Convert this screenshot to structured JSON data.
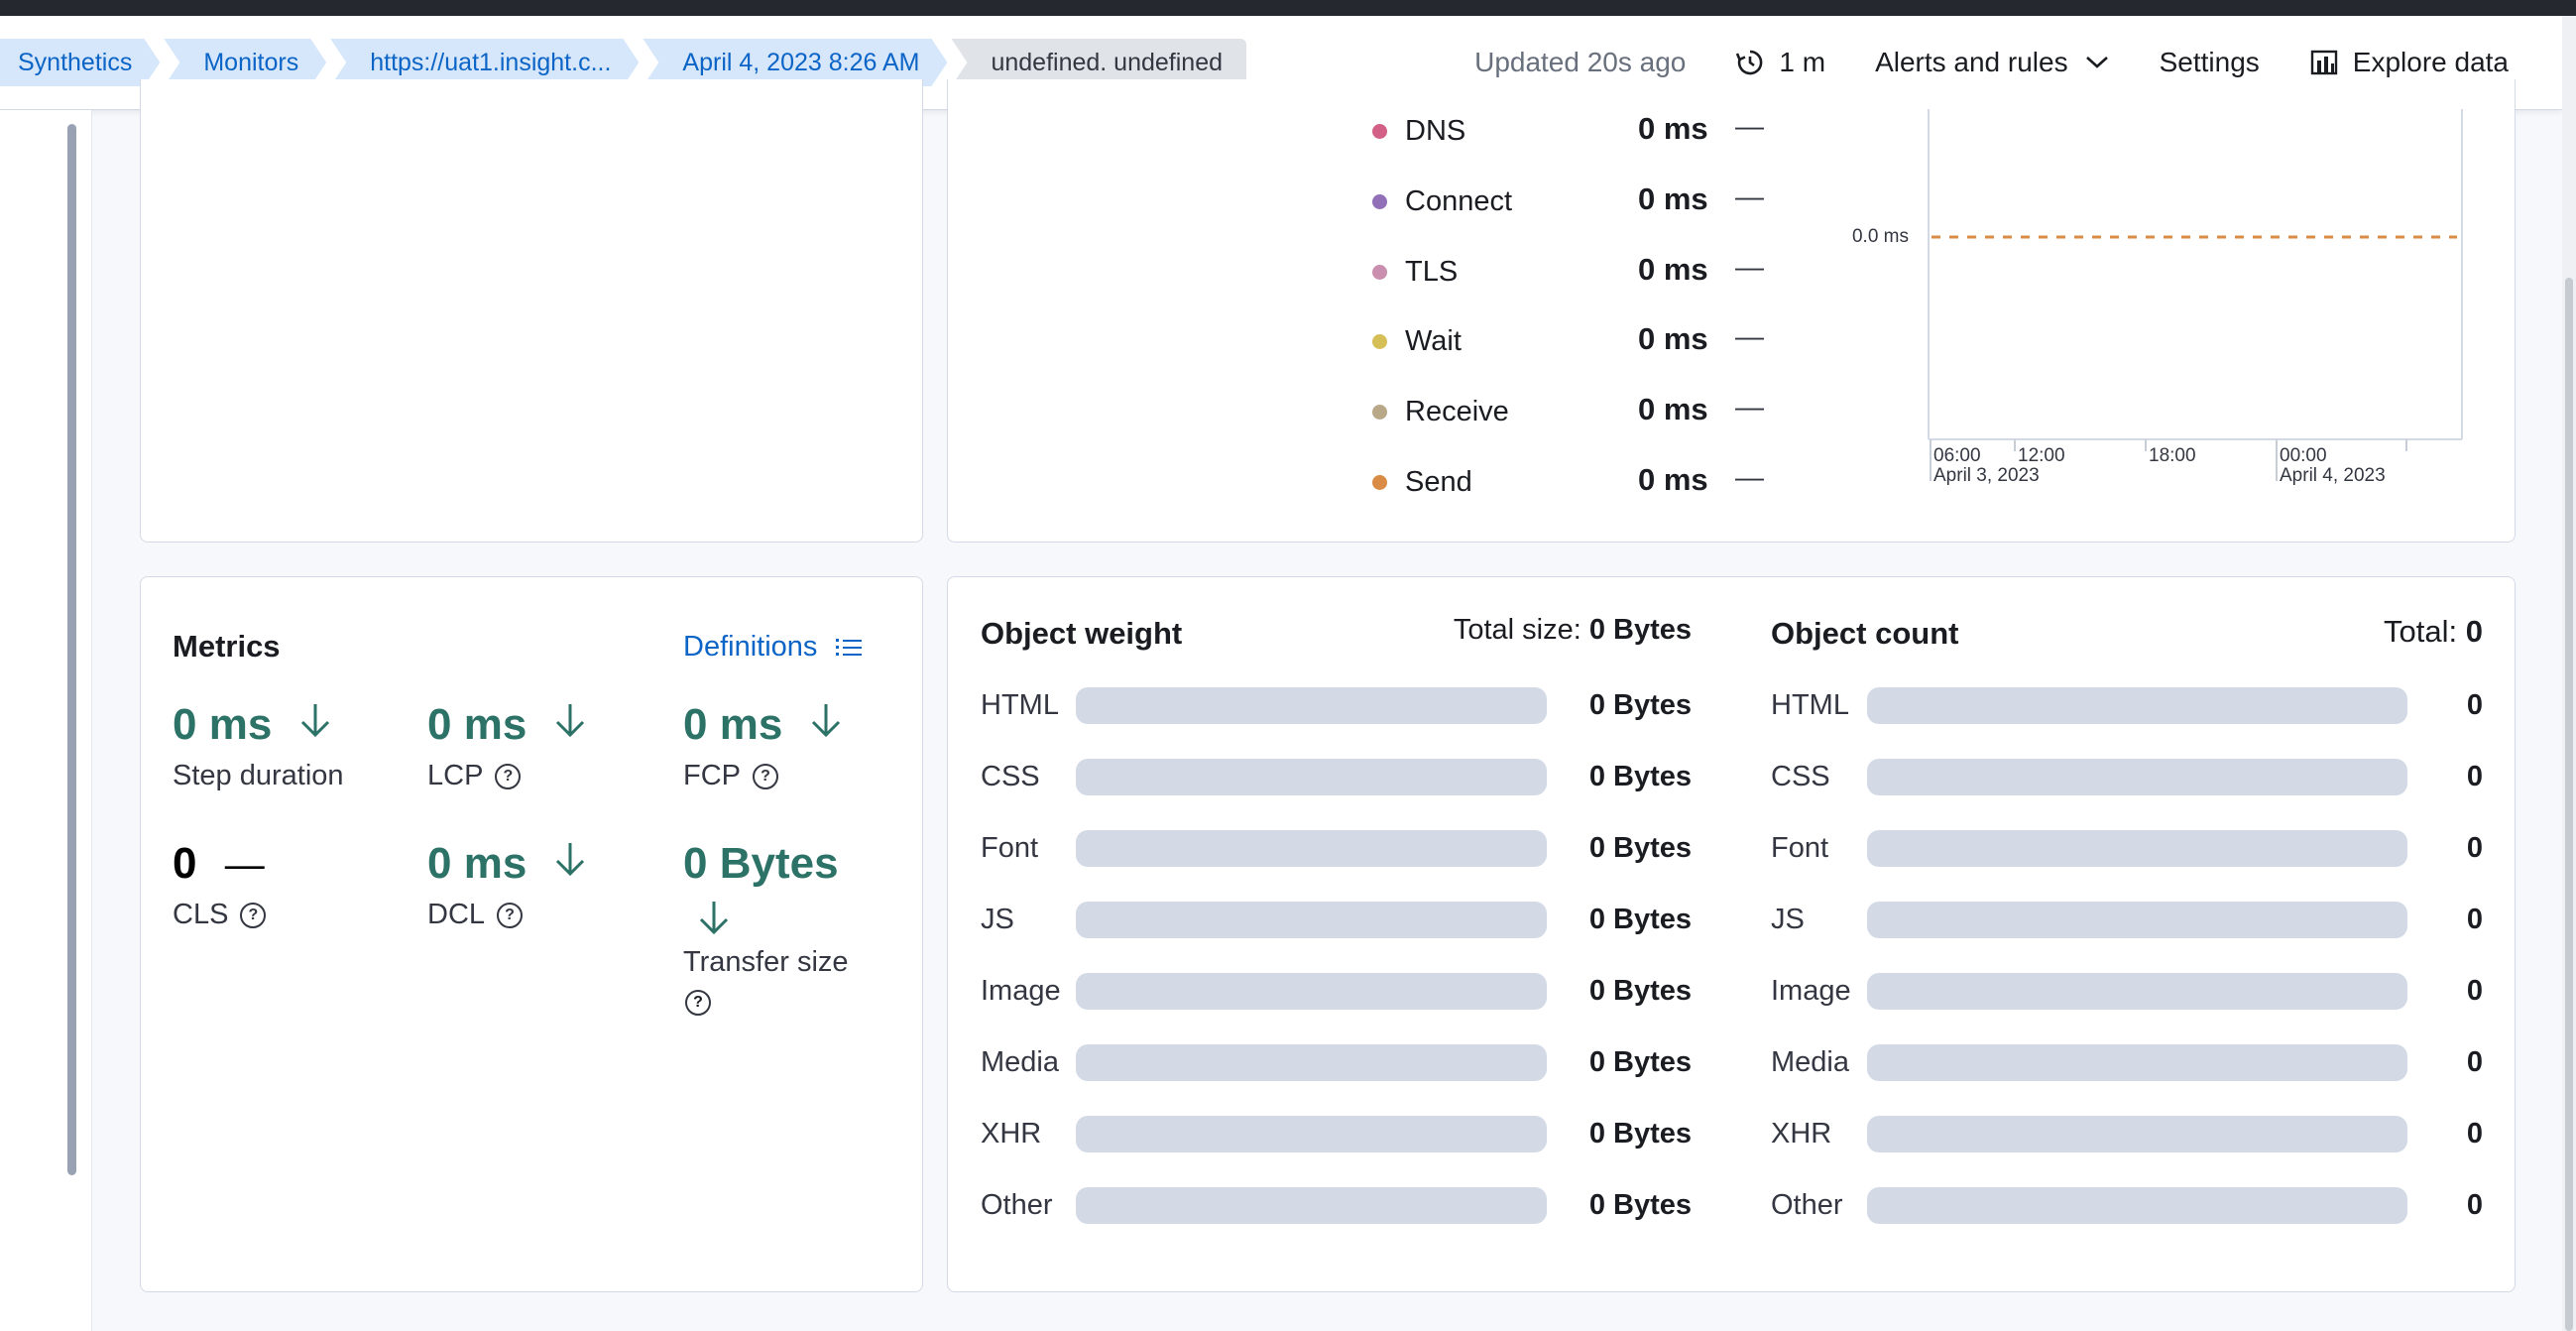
{
  "breadcrumbs": [
    "Synthetics",
    "Monitors",
    "https://uat1.insight.c...",
    "April 4, 2023 8:26 AM",
    "undefined. undefined"
  ],
  "header": {
    "updated": "Updated 20s ago",
    "refresh": "1 m",
    "alerts": "Alerts and rules",
    "settings": "Settings",
    "explore": "Explore data"
  },
  "timings": {
    "items": [
      {
        "label": "DNS",
        "value": "0 ms",
        "trend": "—",
        "color": "#d36086"
      },
      {
        "label": "Connect",
        "value": "0 ms",
        "trend": "—",
        "color": "#9170b8"
      },
      {
        "label": "TLS",
        "value": "0 ms",
        "trend": "—",
        "color": "#ca8eae"
      },
      {
        "label": "Wait",
        "value": "0 ms",
        "trend": "—",
        "color": "#d6bf57"
      },
      {
        "label": "Receive",
        "value": "0 ms",
        "trend": "—",
        "color": "#b9a888"
      },
      {
        "label": "Send",
        "value": "0 ms",
        "trend": "—",
        "color": "#da8b45"
      }
    ]
  },
  "chart_data": {
    "type": "line",
    "x": [
      "06:00",
      "12:00",
      "18:00",
      "00:00"
    ],
    "x_sublabels": [
      "April 3, 2023",
      "",
      "",
      "April 4, 2023"
    ],
    "y_tick": "0.0 ms",
    "series": [
      {
        "values": [
          0,
          0,
          0,
          0
        ],
        "color": "#da8b45",
        "dashed": true
      }
    ]
  },
  "metrics": {
    "title": "Metrics",
    "definitions": "Definitions",
    "step_duration": {
      "value": "0 ms",
      "label": "Step duration"
    },
    "lcp": {
      "value": "0 ms",
      "label": "LCP"
    },
    "fcp": {
      "value": "0 ms",
      "label": "FCP"
    },
    "cls": {
      "value": "0",
      "label": "CLS",
      "trend": "—"
    },
    "dcl": {
      "value": "0 ms",
      "label": "DCL"
    },
    "transfer": {
      "value": "0 Bytes",
      "label": "Transfer size"
    }
  },
  "object_weight": {
    "title": "Object weight",
    "total_label": "Total size:",
    "total_value": "0 Bytes",
    "rows": [
      {
        "label": "HTML",
        "value": "0 Bytes"
      },
      {
        "label": "CSS",
        "value": "0 Bytes"
      },
      {
        "label": "Font",
        "value": "0 Bytes"
      },
      {
        "label": "JS",
        "value": "0 Bytes"
      },
      {
        "label": "Image",
        "value": "0 Bytes"
      },
      {
        "label": "Media",
        "value": "0 Bytes"
      },
      {
        "label": "XHR",
        "value": "0 Bytes"
      },
      {
        "label": "Other",
        "value": "0 Bytes"
      }
    ]
  },
  "object_count": {
    "title": "Object count",
    "total_label": "Total:",
    "total_value": "0",
    "rows": [
      {
        "label": "HTML",
        "value": "0"
      },
      {
        "label": "CSS",
        "value": "0"
      },
      {
        "label": "Font",
        "value": "0"
      },
      {
        "label": "JS",
        "value": "0"
      },
      {
        "label": "Image",
        "value": "0"
      },
      {
        "label": "Media",
        "value": "0"
      },
      {
        "label": "XHR",
        "value": "0"
      },
      {
        "label": "Other",
        "value": "0"
      }
    ]
  }
}
